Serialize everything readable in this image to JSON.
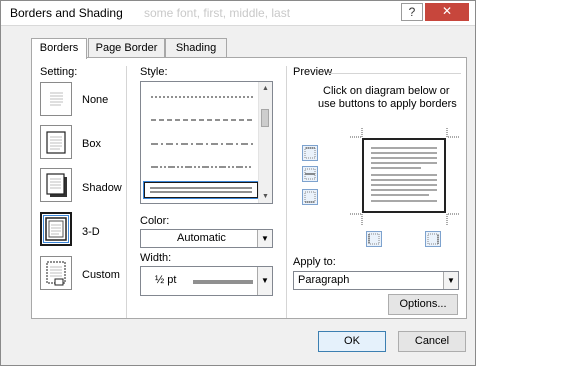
{
  "window": {
    "title": "Borders and Shading",
    "background_text": "some font, first, middle, last",
    "help_label": "?",
    "close_label": "✕"
  },
  "tabs": [
    {
      "label": "Borders",
      "active": true
    },
    {
      "label": "Page Border",
      "active": false
    },
    {
      "label": "Shading",
      "active": false
    }
  ],
  "setting": {
    "heading": "Setting:",
    "options": [
      {
        "label": "None",
        "icon": "none-setting-icon"
      },
      {
        "label": "Box",
        "icon": "box-setting-icon"
      },
      {
        "label": "Shadow",
        "icon": "shadow-setting-icon"
      },
      {
        "label": "3-D",
        "icon": "3d-setting-icon",
        "selected": true
      },
      {
        "label": "Custom",
        "icon": "custom-setting-icon"
      }
    ]
  },
  "style": {
    "heading": "Style:",
    "lines": [
      "dotted",
      "dashed",
      "dash-dot",
      "dash-dot-dot",
      "double"
    ],
    "selected": "double"
  },
  "color": {
    "heading": "Color:",
    "value": "Automatic"
  },
  "width": {
    "heading": "Width:",
    "value": "½ pt"
  },
  "preview": {
    "heading": "Preview",
    "instruction_line1": "Click on diagram below or",
    "instruction_line2": "use buttons to apply borders"
  },
  "apply_to": {
    "heading": "Apply to:",
    "value": "Paragraph"
  },
  "buttons": {
    "options": "Options...",
    "ok": "OK",
    "cancel": "Cancel"
  },
  "colors": {
    "accent": "#3b86d8",
    "close": "#c7463c",
    "dialog_bg": "#f0f0f0"
  }
}
